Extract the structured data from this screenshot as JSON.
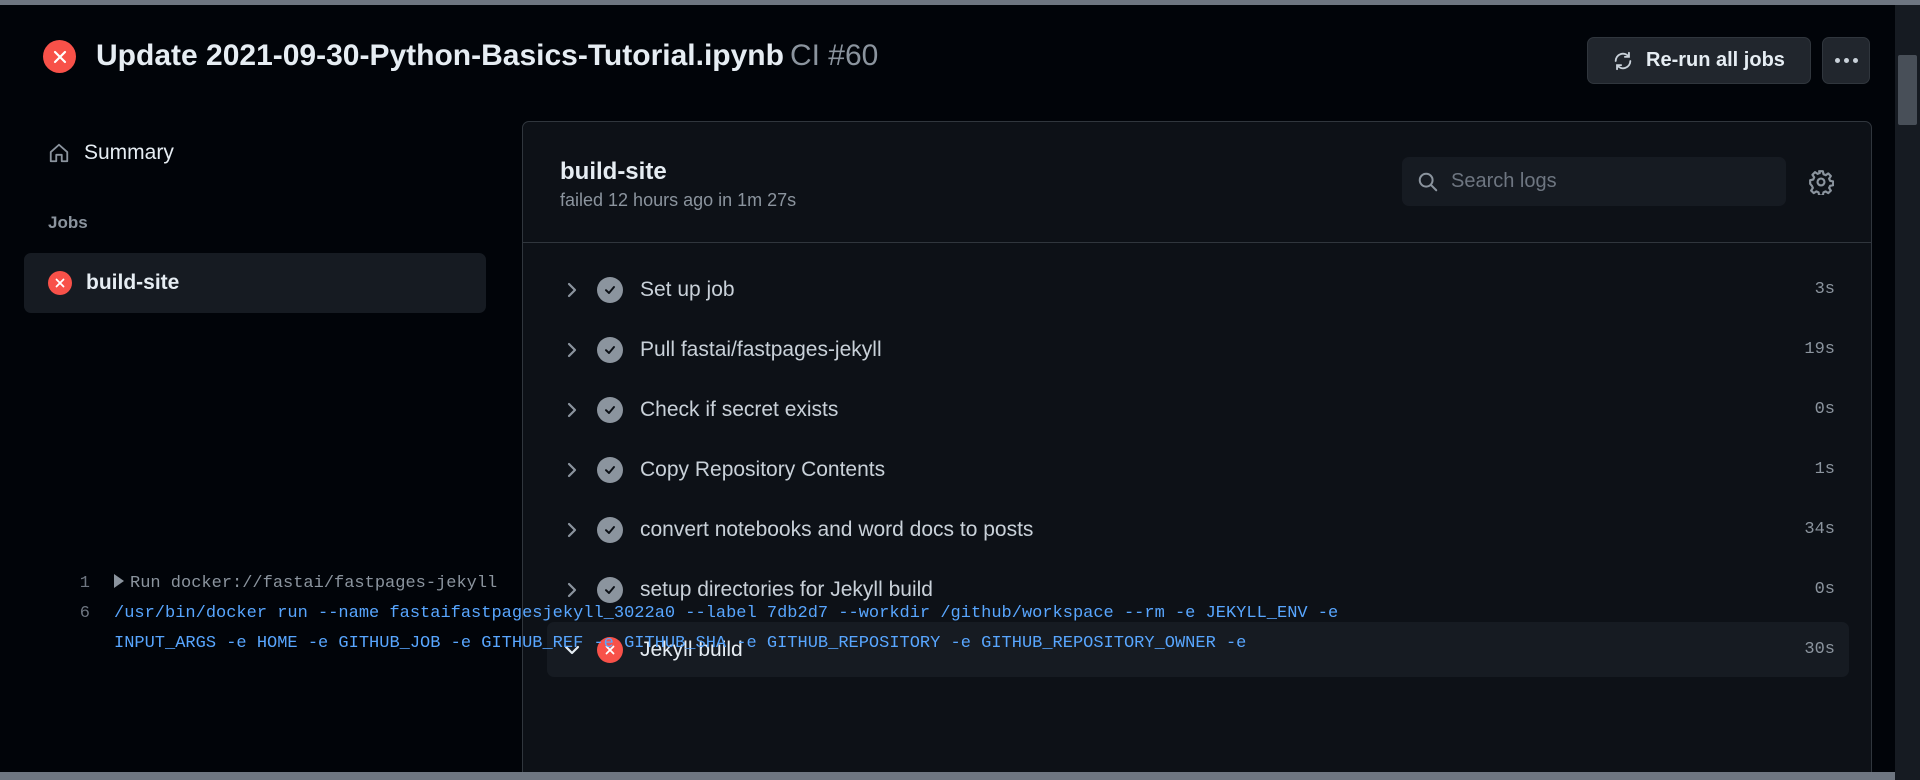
{
  "header": {
    "title": "Update 2021-09-30-Python-Basics-Tutorial.ipynb",
    "ci_label": "CI #60",
    "rerun_label": "Re-run all jobs"
  },
  "sidebar": {
    "summary_label": "Summary",
    "jobs_heading": "Jobs",
    "job_label": "build-site"
  },
  "job": {
    "title": "build-site",
    "meta": "failed 12 hours ago in 1m 27s",
    "search_placeholder": "Search logs"
  },
  "steps": [
    {
      "name": "Set up job",
      "duration": "3s",
      "status": "success"
    },
    {
      "name": "Pull fastai/fastpages-jekyll",
      "duration": "19s",
      "status": "success"
    },
    {
      "name": "Check if secret exists",
      "duration": "0s",
      "status": "success"
    },
    {
      "name": "Copy Repository Contents",
      "duration": "1s",
      "status": "success"
    },
    {
      "name": "convert notebooks and word docs to posts",
      "duration": "34s",
      "status": "success"
    },
    {
      "name": "setup directories for Jekyll build",
      "duration": "0s",
      "status": "success"
    },
    {
      "name": "Jekyll build",
      "duration": "30s",
      "status": "failure"
    }
  ],
  "log": [
    {
      "num": "1",
      "text": "Run docker://fastai/fastpages-jekyll"
    },
    {
      "num": "6",
      "text": "/usr/bin/docker run --name fastaifastpagesjekyll_3022a0 --label 7db2d7 --workdir /github/workspace --rm -e JEKYLL_ENV -e"
    },
    {
      "num": "",
      "text": "INPUT_ARGS -e HOME -e GITHUB_JOB -e GITHUB_REF -e GITHUB_SHA -e GITHUB_REPOSITORY -e GITHUB_REPOSITORY_OWNER -e"
    }
  ],
  "colors": {
    "failure": "#f85149",
    "success": "#8b949e",
    "link": "#58a6ff"
  }
}
